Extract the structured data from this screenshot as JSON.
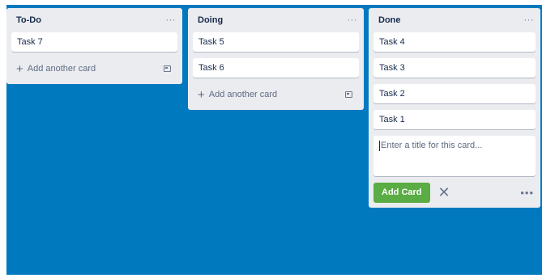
{
  "lists": [
    {
      "title": "To-Do",
      "cards": [
        "Task 7"
      ],
      "add_label": "Add another card"
    },
    {
      "title": "Doing",
      "cards": [
        "Task 5",
        "Task 6"
      ],
      "add_label": "Add another card"
    },
    {
      "title": "Done",
      "cards": [
        "Task 4",
        "Task 3",
        "Task 2",
        "Task 1"
      ],
      "composer": {
        "placeholder": "Enter a title for this card...",
        "submit_label": "Add Card"
      }
    }
  ],
  "icons": {
    "list_menu": "more-horizontal-icon",
    "add": "plus-icon",
    "template": "card-template-icon",
    "close": "close-icon",
    "more": "more-dots-icon"
  },
  "colors": {
    "board_background": "#0079bf",
    "list_background": "#ebecf0",
    "add_card_button": "#5aac44"
  }
}
